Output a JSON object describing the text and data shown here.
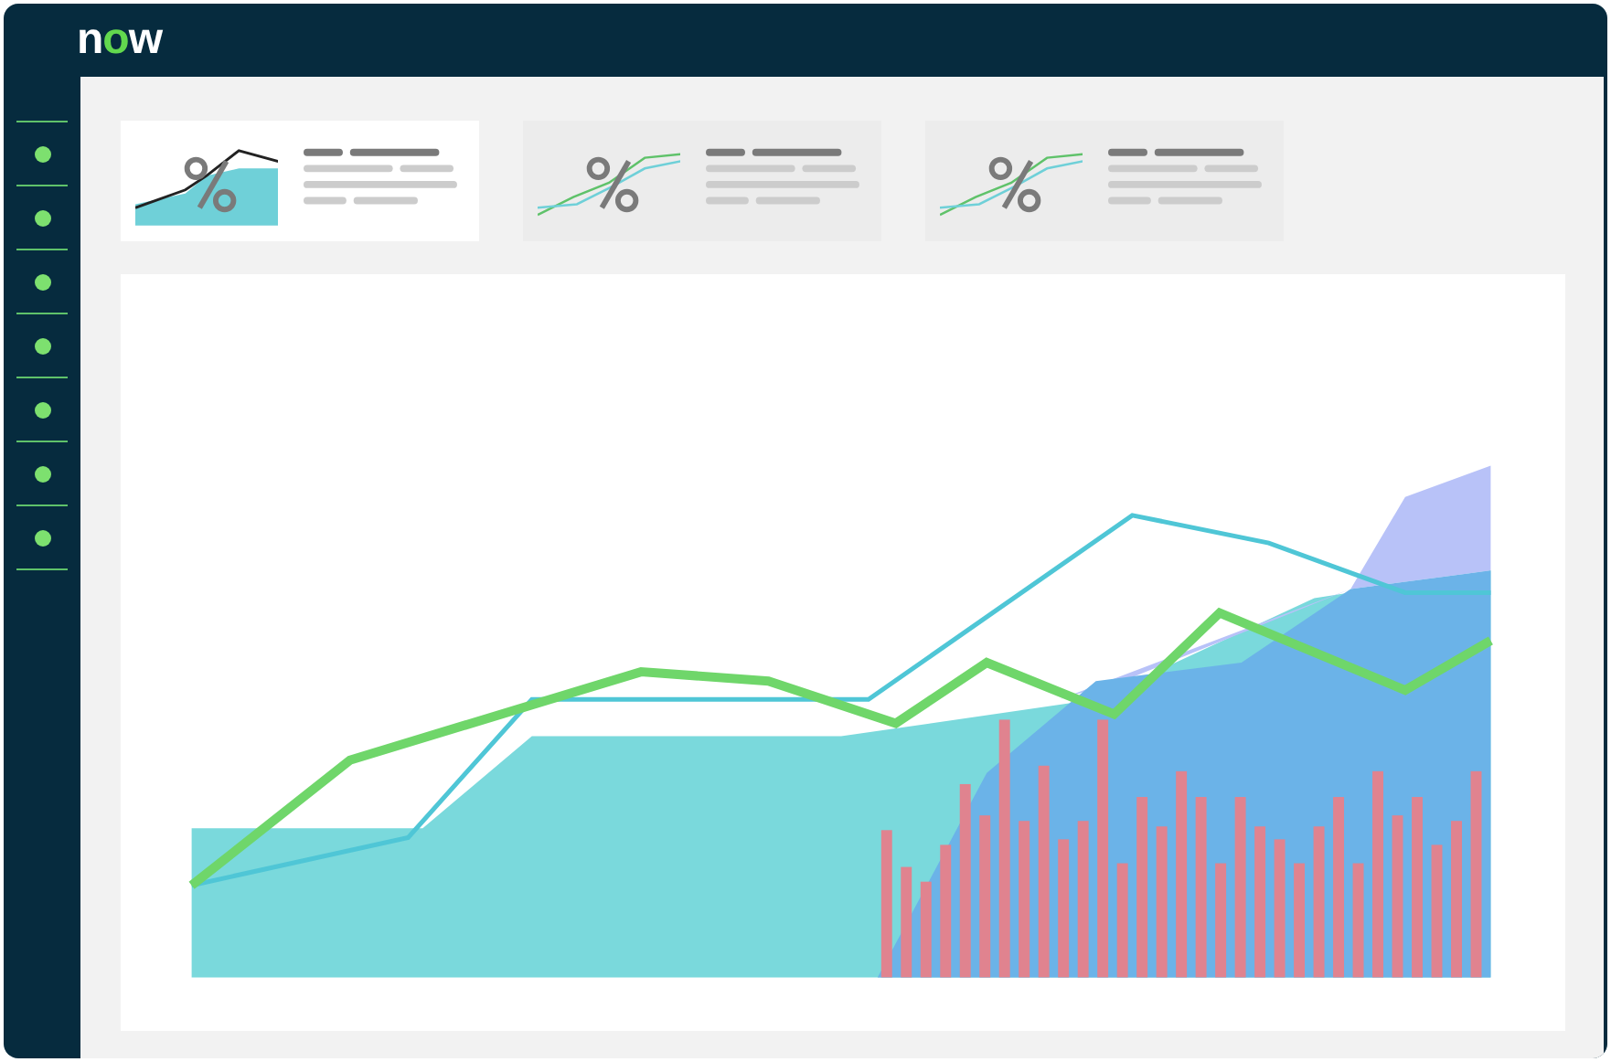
{
  "header": {
    "logo": "now"
  },
  "cards": [
    {
      "selected": true,
      "kind": "area"
    },
    {
      "selected": false,
      "kind": "lines"
    },
    {
      "selected": false,
      "kind": "lines"
    }
  ]
}
